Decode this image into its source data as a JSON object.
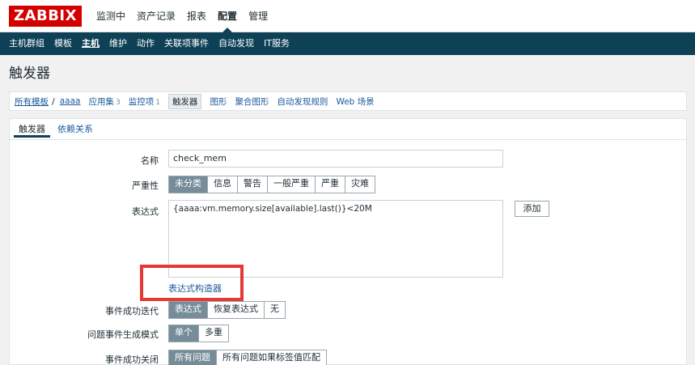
{
  "app": {
    "logo": "ZABBIX"
  },
  "top_menu": [
    {
      "label": "监测中",
      "active": false
    },
    {
      "label": "资产记录",
      "active": false
    },
    {
      "label": "报表",
      "active": false
    },
    {
      "label": "配置",
      "active": true
    },
    {
      "label": "管理",
      "active": false
    }
  ],
  "sub_menu": [
    {
      "label": "主机群组",
      "active": false
    },
    {
      "label": "模板",
      "active": false
    },
    {
      "label": "主机",
      "active": true
    },
    {
      "label": "维护",
      "active": false
    },
    {
      "label": "动作",
      "active": false
    },
    {
      "label": "关联项事件",
      "active": false
    },
    {
      "label": "自动发现",
      "active": false
    },
    {
      "label": "IT服务",
      "active": false
    }
  ],
  "page_title": "触发器",
  "host_nav": {
    "all_templates": "所有模板",
    "separator": "/",
    "host": "aaaa",
    "applications": "应用集",
    "applications_count": "3",
    "items": "监控项",
    "items_count": "1",
    "triggers": "触发器",
    "graphs": "图形",
    "screens": "聚合图形",
    "discovery": "自动发现规则",
    "web": "Web 场景"
  },
  "tabs": {
    "trigger": "触发器",
    "dependencies": "依赖关系"
  },
  "form": {
    "name_label": "名称",
    "name_value": "check_mem",
    "severity_label": "严重性",
    "severity_options": [
      "未分类",
      "信息",
      "警告",
      "一般严重",
      "严重",
      "灾难"
    ],
    "severity_selected": 0,
    "expression_label": "表达式",
    "expression_value": "{aaaa:vm.memory.size[available].last()}<20M",
    "add_button": "添加",
    "expression_constructor": "表达式构造器",
    "ok_event_gen_label": "事件成功迭代",
    "ok_event_gen_options": [
      "表达式",
      "恢复表达式",
      "无"
    ],
    "ok_event_gen_selected": 0,
    "problem_mode_label": "问题事件生成模式",
    "problem_mode_options": [
      "单个",
      "多重"
    ],
    "problem_mode_selected": 0,
    "ok_close_label": "事件成功关闭",
    "ok_close_options": [
      "所有问题",
      "所有问题如果标签值匹配"
    ],
    "ok_close_selected": 0
  },
  "colors": {
    "brand_red": "#d40000",
    "nav_dark": "#0e4156",
    "link_blue": "#1a5a9b",
    "selected_segment": "#768d99",
    "highlight_red": "#e53935"
  }
}
